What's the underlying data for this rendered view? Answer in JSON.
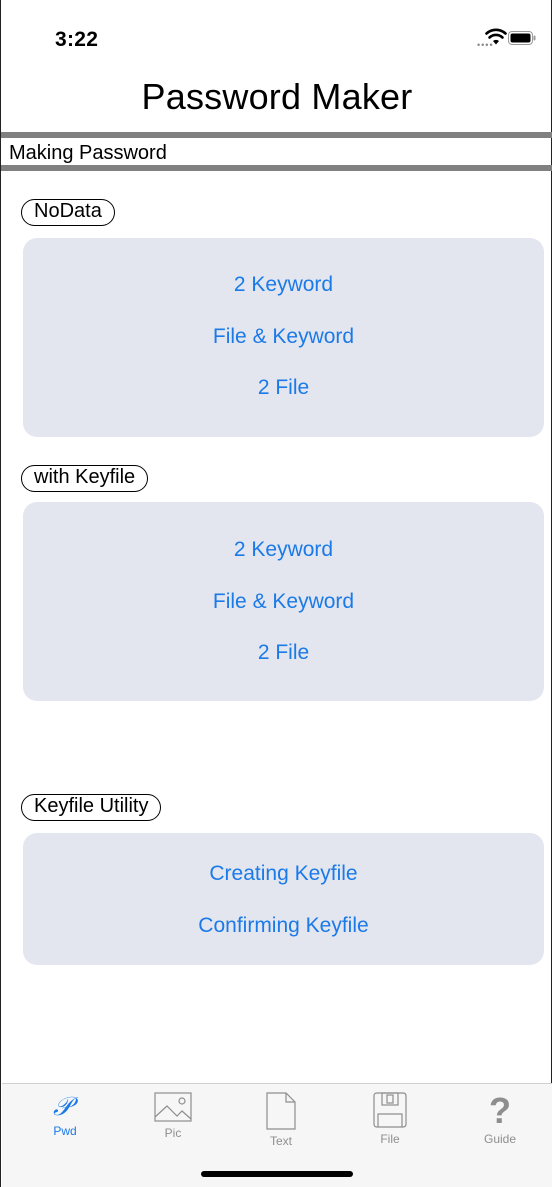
{
  "status": {
    "time": "3:22"
  },
  "header": {
    "title": "Password Maker"
  },
  "section": {
    "label": "Making Password"
  },
  "groups": [
    {
      "label": "NoData",
      "buttons": [
        "2 Keyword",
        "File & Keyword",
        "2 File"
      ]
    },
    {
      "label": "with Keyfile",
      "buttons": [
        "2 Keyword",
        "File & Keyword",
        "2 File"
      ]
    },
    {
      "label": "Keyfile Utility",
      "buttons": [
        "Creating Keyfile",
        "Confirming Keyfile"
      ]
    }
  ],
  "tabbar": {
    "active": "Pwd",
    "items": [
      {
        "label": "Pwd",
        "icon": "script-p-icon"
      },
      {
        "label": "Pic",
        "icon": "picture-icon"
      },
      {
        "label": "Text",
        "icon": "document-icon"
      },
      {
        "label": "File",
        "icon": "floppy-disk-icon"
      },
      {
        "label": "Guide",
        "icon": "question-mark-icon"
      }
    ]
  },
  "colors": {
    "accent": "#1a7ae8",
    "card": "#e4e6ef",
    "divider": "#808080"
  }
}
